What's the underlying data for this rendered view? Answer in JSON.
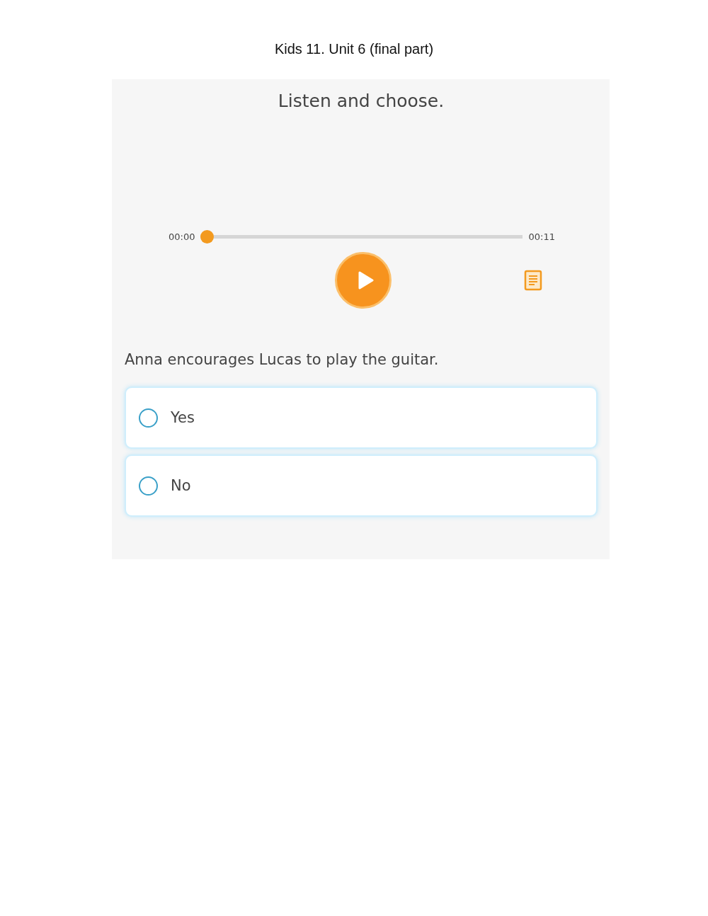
{
  "page_title": "Kids 11. Unit 6 (final part)",
  "app": {
    "instruction": "Listen and choose.",
    "player": {
      "current_time": "00:00",
      "total_time": "00:11",
      "level": 0,
      "playing": false
    },
    "question": "Anna encourages Lucas to play the guitar.",
    "options": [
      {
        "label": "Yes",
        "selected": false
      },
      {
        "label": "No",
        "selected": false
      }
    ]
  }
}
